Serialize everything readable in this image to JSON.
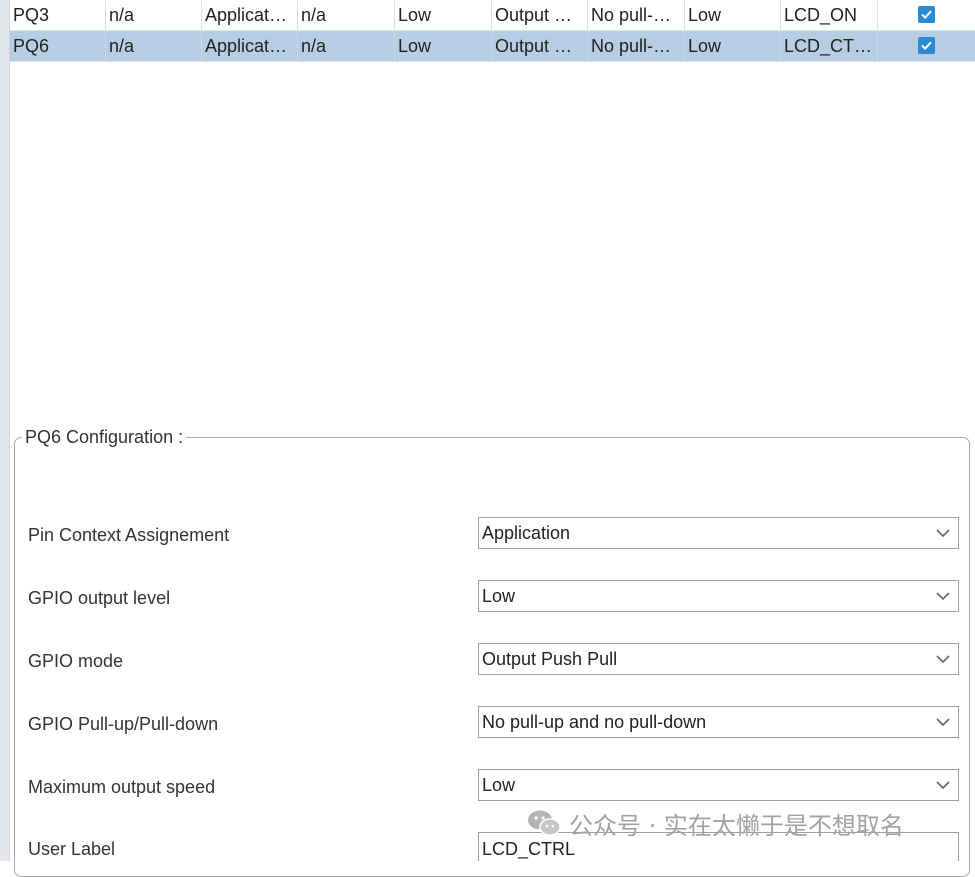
{
  "table": {
    "rows": [
      {
        "pin": "PQ3",
        "c1": "n/a",
        "c2": "Applicat…",
        "c3": "n/a",
        "c4": "Low",
        "c5": "Output …",
        "c6": "No pull-…",
        "c7": "Low",
        "c8": "LCD_ON",
        "checked": true,
        "selected": false
      },
      {
        "pin": "PQ6",
        "c1": "n/a",
        "c2": "Applicat…",
        "c3": "n/a",
        "c4": "Low",
        "c5": "Output …",
        "c6": "No pull-…",
        "c7": "Low",
        "c8": "LCD_CT…",
        "checked": true,
        "selected": true
      }
    ]
  },
  "config": {
    "title": "PQ6 Configuration :",
    "fields": [
      {
        "label": "Pin Context Assignement",
        "value": "Application",
        "type": "select"
      },
      {
        "label": "GPIO output level",
        "value": "Low",
        "type": "select"
      },
      {
        "label": "GPIO mode",
        "value": "Output Push Pull",
        "type": "select"
      },
      {
        "label": "GPIO Pull-up/Pull-down",
        "value": "No pull-up and no pull-down",
        "type": "select"
      },
      {
        "label": "Maximum output speed",
        "value": "Low",
        "type": "select"
      },
      {
        "label": "User Label",
        "value": "LCD_CTRL",
        "type": "text"
      }
    ]
  },
  "watermark": {
    "text": "公众号 · 实在太懒于是不想取名",
    "icon": "wechat-icon"
  },
  "colors": {
    "selected_row": "#b7cde4",
    "checkbox": "#2b8ad6"
  }
}
